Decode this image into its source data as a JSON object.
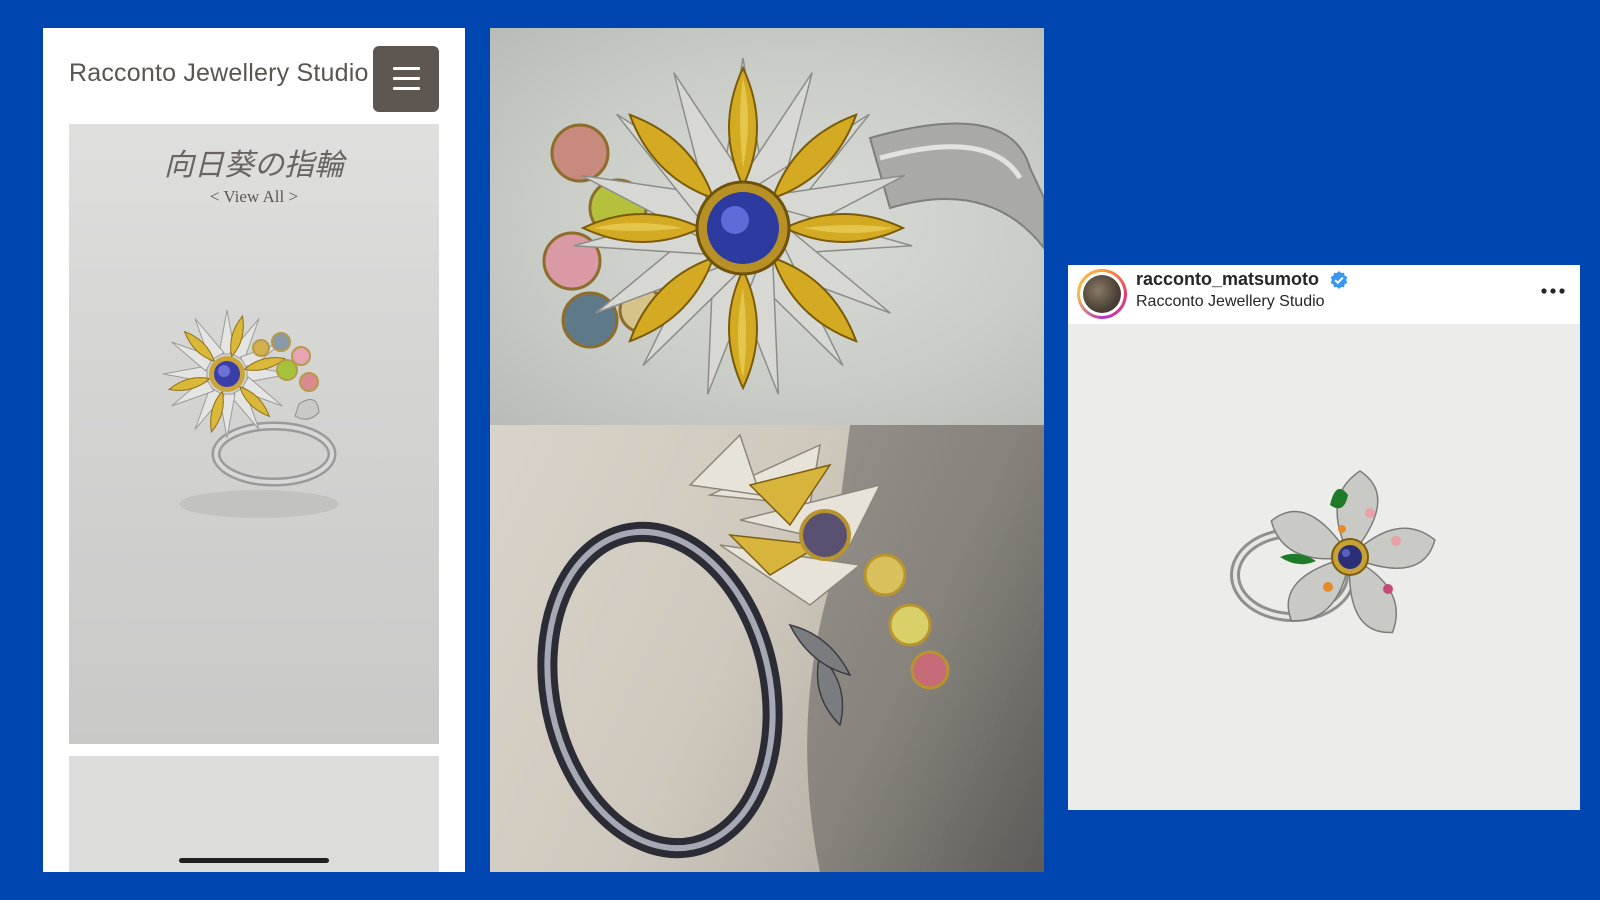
{
  "website": {
    "site_title": "Racconto Jewellery Studio",
    "menu_icon": "hamburger-icon",
    "hero_title": "向日葵の指輪",
    "hero_link": "< View All >"
  },
  "photos": {
    "top": "sunflower-ring-front-photo",
    "bottom": "sunflower-ring-side-photo"
  },
  "instagram": {
    "username": "racconto_matsumoto",
    "verified_icon": "verified-badge-icon",
    "subtitle": "Racconto Jewellery Studio",
    "more_icon": "more-options-icon"
  },
  "colors": {
    "background": "#0046b1",
    "menu_button": "#5e5650",
    "verified": "#3897f0"
  }
}
